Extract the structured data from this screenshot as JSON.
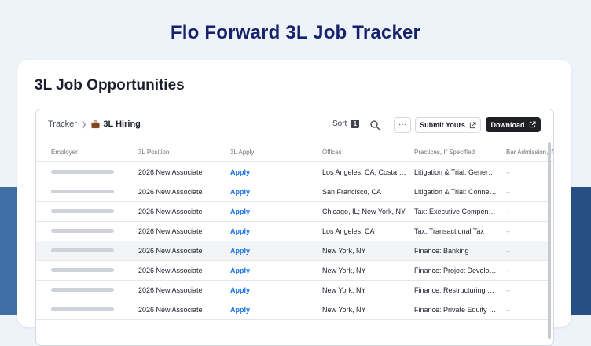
{
  "hero": {
    "title": "Flo Forward 3L Job Tracker"
  },
  "card": {
    "title": "3L Job Opportunities"
  },
  "toolbar": {
    "breadcrumb_root": "Tracker",
    "breadcrumb_current": "3L Hiring",
    "breadcrumb_icon": "briefcase-icon",
    "sort_label": "Sort",
    "sort_count": "1",
    "more_label": "···",
    "submit_label": "Submit Yours",
    "download_label": "Download"
  },
  "table": {
    "columns": [
      "Employer",
      "3L Position",
      "3L Apply",
      "Offices",
      "Practices, If Specified",
      "Bar Admission, If"
    ],
    "rows": [
      {
        "position": "2026 New Associate",
        "apply": "Apply",
        "offices": "Los Angeles, CA; Costa Mesa, CA",
        "practices": "Litigation & Trial: General Litigation",
        "bar": "–"
      },
      {
        "position": "2026 New Associate",
        "apply": "Apply",
        "offices": "San Francisco, CA",
        "practices": "Litigation & Trial: Connecticut",
        "bar": "–"
      },
      {
        "position": "2026 New Associate",
        "apply": "Apply",
        "offices": "Chicago, IL; New York, NY",
        "practices": "Tax: Executive Compensation",
        "bar": "–"
      },
      {
        "position": "2026 New Associate",
        "apply": "Apply",
        "offices": "Los Angeles, CA",
        "practices": "Tax: Transactional Tax",
        "bar": "–"
      },
      {
        "position": "2026 New Associate",
        "apply": "Apply",
        "offices": "New York, NY",
        "practices": "Finance: Banking",
        "bar": "–"
      },
      {
        "position": "2026 New Associate",
        "apply": "Apply",
        "offices": "New York, NY",
        "practices": "Finance: Project Development",
        "bar": "–"
      },
      {
        "position": "2026 New Associate",
        "apply": "Apply",
        "offices": "New York, NY",
        "practices": "Finance: Restructuring & Special Situations",
        "bar": "–"
      },
      {
        "position": "2026 New Associate",
        "apply": "Apply",
        "offices": "New York, NY",
        "practices": "Finance: Private Equity Finance",
        "bar": "–"
      }
    ]
  },
  "colors": {
    "accent": "#1a73e8",
    "hero_title": "#16236b",
    "band": "#2f5d92"
  }
}
